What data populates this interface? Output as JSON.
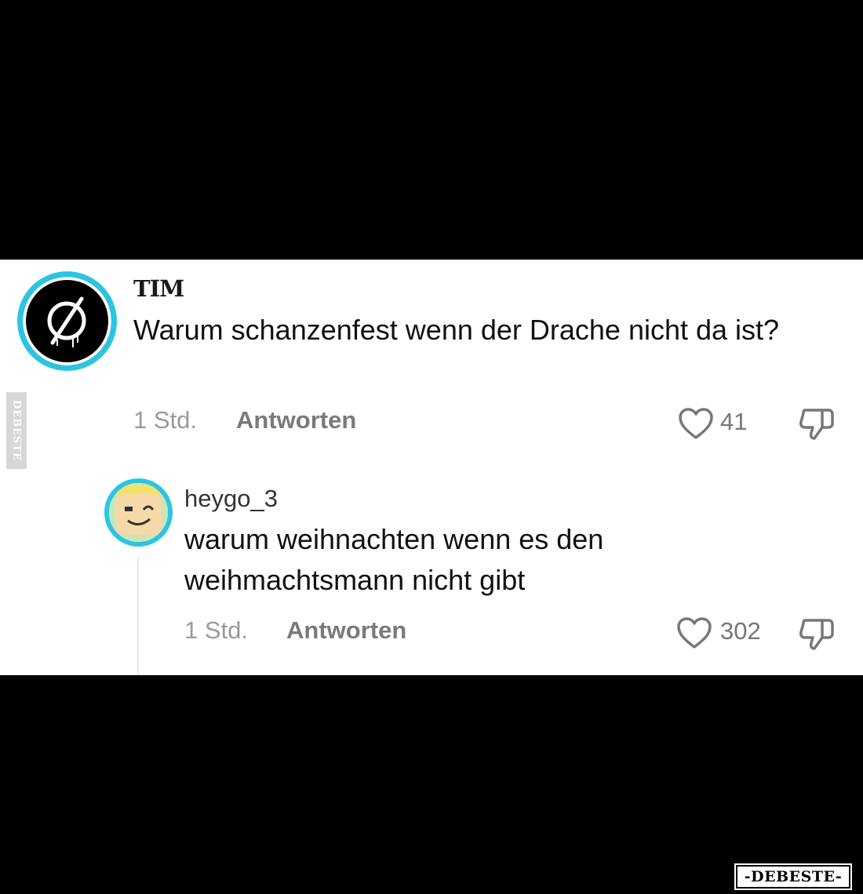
{
  "comments": [
    {
      "username": "TIM",
      "text": "Warum schanzenfest wenn der Drache nicht da ist?",
      "time": "1 Std.",
      "reply_label": "Antworten",
      "likes": "41"
    },
    {
      "username": "heygo_3",
      "text": "warum weihnachten wenn es den weihmachtsmann nicht gibt",
      "time": "1 Std.",
      "reply_label": "Antworten",
      "likes": "302"
    }
  ],
  "watermarks": {
    "side": "DEBESTE",
    "bottom": "-DEBESTE-"
  },
  "colors": {
    "avatar_ring": "#2bc5e2",
    "background": "#000000",
    "panel": "#ffffff"
  },
  "icons": [
    "like-heart-icon",
    "dislike-thumb-icon"
  ]
}
